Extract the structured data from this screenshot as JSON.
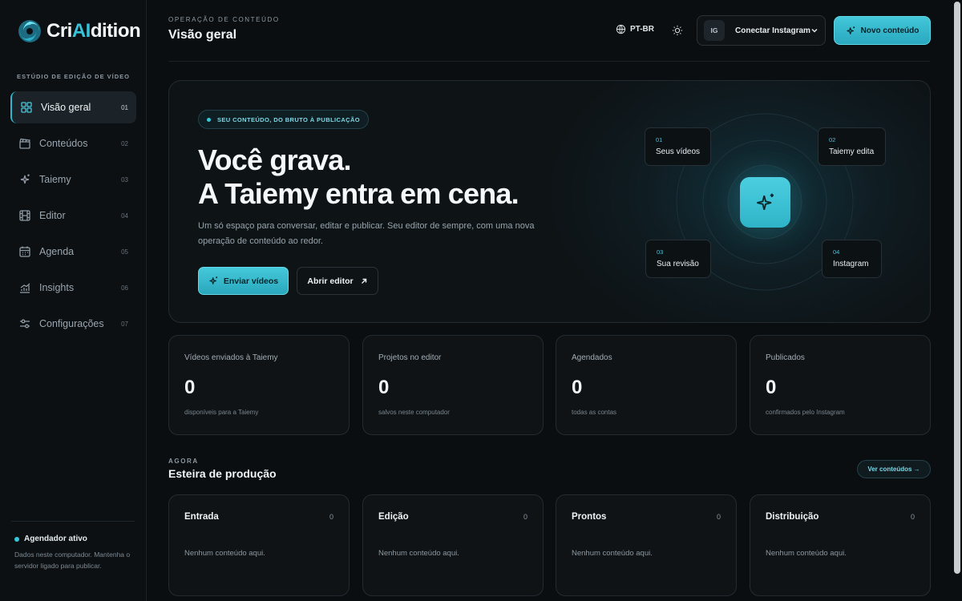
{
  "brand": {
    "name_pre": "Cri",
    "name_ai": "AI",
    "name_post": "dition"
  },
  "sidebar": {
    "caption": "ESTÚDIO DE EDIÇÃO DE VÍDEO",
    "items": [
      {
        "label": "Visão geral",
        "num": "01",
        "icon": "grid-icon",
        "active": true
      },
      {
        "label": "Conteúdos",
        "num": "02",
        "icon": "clapperboard-icon"
      },
      {
        "label": "Taiemy",
        "num": "03",
        "icon": "sparkles-icon"
      },
      {
        "label": "Editor",
        "num": "04",
        "icon": "film-icon"
      },
      {
        "label": "Agenda",
        "num": "05",
        "icon": "calendar-icon"
      },
      {
        "label": "Insights",
        "num": "06",
        "icon": "chart-icon"
      },
      {
        "label": "Configurações",
        "num": "07",
        "icon": "sliders-icon"
      }
    ],
    "scheduler": {
      "title": "Agendador ativo",
      "desc": "Dados neste computador. Mantenha o servidor ligado para publicar."
    }
  },
  "header": {
    "eyebrow": "OPERAÇÃO DE CONTEÚDO",
    "title": "Visão geral",
    "language": "PT-BR",
    "ig_badge": "IG",
    "ig_label": "Conectar Instagram",
    "new_button": "Novo conteúdo"
  },
  "hero": {
    "pill": "SEU CONTEÚDO, DO BRUTO À PUBLICAÇÃO",
    "headline_1": "Você grava.",
    "headline_2": "A Taiemy entra em cena.",
    "paragraph": "Um só espaço para conversar, editar e publicar. Seu editor de sempre, com uma nova operação de conteúdo ao redor.",
    "send_button": "Enviar vídeos",
    "editor_button": "Abrir editor",
    "steps": [
      {
        "num": "01",
        "label": "Seus vídeos"
      },
      {
        "num": "02",
        "label": "Taiemy edita"
      },
      {
        "num": "03",
        "label": "Sua revisão"
      },
      {
        "num": "04",
        "label": "Instagram"
      }
    ]
  },
  "stats": [
    {
      "label": "Vídeos enviados à Taiemy",
      "value": "0",
      "sub": "disponíveis para a Taiemy"
    },
    {
      "label": "Projetos no editor",
      "value": "0",
      "sub": "salvos neste computador"
    },
    {
      "label": "Agendados",
      "value": "0",
      "sub": "todas as contas"
    },
    {
      "label": "Publicados",
      "value": "0",
      "sub": "confirmados pelo Instagram"
    }
  ],
  "production": {
    "eyebrow": "AGORA",
    "title": "Esteira de produção",
    "view_button": "Ver conteúdos →",
    "lanes": [
      {
        "title": "Entrada",
        "count": "0",
        "empty": "Nenhum conteúdo aqui."
      },
      {
        "title": "Edição",
        "count": "0",
        "empty": "Nenhum conteúdo aqui."
      },
      {
        "title": "Prontos",
        "count": "0",
        "empty": "Nenhum conteúdo aqui."
      },
      {
        "title": "Distribuição",
        "count": "0",
        "empty": "Nenhum conteúdo aqui."
      }
    ]
  },
  "colors": {
    "accent": "#36c3d8",
    "background": "#0b0e11",
    "card": "#0f1316"
  }
}
